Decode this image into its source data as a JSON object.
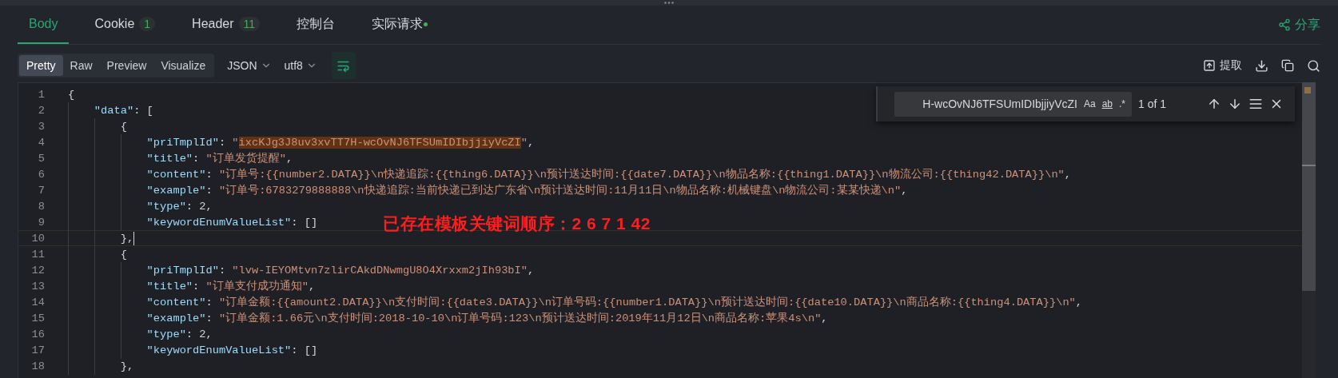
{
  "tabs": [
    {
      "label": "Body",
      "selected": true
    },
    {
      "label": "Cookie",
      "badge": "1",
      "selected": false
    },
    {
      "label": "Header",
      "badge": "11",
      "selected": false
    },
    {
      "label": "控制台",
      "selected": false
    },
    {
      "label": "实际请求",
      "dot": true,
      "selected": false
    }
  ],
  "share": {
    "label": "分享"
  },
  "view_modes": [
    {
      "label": "Pretty",
      "selected": true
    },
    {
      "label": "Raw",
      "selected": false
    },
    {
      "label": "Preview",
      "selected": false
    },
    {
      "label": "Visualize",
      "selected": false
    }
  ],
  "dropdowns": [
    {
      "value": "JSON"
    },
    {
      "value": "utf8"
    }
  ],
  "wrap": {
    "on": true
  },
  "extract": {
    "label": "提取"
  },
  "find": {
    "value": "H-wcOvNJ6TFSUmIDIbjjiyVcZI",
    "options": [
      {
        "label": "Aa"
      },
      {
        "label": "ab"
      },
      {
        "label": ".*"
      }
    ],
    "count": "1 of 1"
  },
  "annotation": "已存在模板关键词顺序：2 6 7 1 42",
  "lines": [
    {
      "number": "1",
      "current": false,
      "tokens": [
        {
          "kind": "punct",
          "text": "{"
        }
      ]
    },
    {
      "number": "2",
      "current": false,
      "tokens": [
        {
          "kind": "key",
          "text": "    \"data\""
        },
        {
          "kind": "punct",
          "text": ": ["
        }
      ]
    },
    {
      "number": "3",
      "current": false,
      "tokens": [
        {
          "kind": "punct",
          "text": "        {"
        }
      ]
    },
    {
      "number": "4",
      "current": false,
      "tokens": [
        {
          "kind": "key",
          "text": "            \"priTmplId\""
        },
        {
          "kind": "punct",
          "text": ": "
        },
        {
          "kind": "string",
          "text": "\""
        },
        {
          "kind": "match",
          "text": "ixcKJg3J8uv3xvTT7H-wcOvNJ6TFSUmIDIbjjiyVcZI"
        },
        {
          "kind": "string",
          "text": "\""
        },
        {
          "kind": "punct",
          "text": ","
        }
      ]
    },
    {
      "number": "5",
      "current": false,
      "tokens": [
        {
          "kind": "key",
          "text": "            \"title\""
        },
        {
          "kind": "punct",
          "text": ": "
        },
        {
          "kind": "string",
          "text": "\"订单发货提醒\""
        },
        {
          "kind": "punct",
          "text": ","
        }
      ]
    },
    {
      "number": "6",
      "current": false,
      "tokens": [
        {
          "kind": "key",
          "text": "            \"content\""
        },
        {
          "kind": "punct",
          "text": ": "
        },
        {
          "kind": "string",
          "text": "\"订单号:{{number2.DATA}}\\n快递追踪:{{thing6.DATA}}\\n预计送达时间:{{date7.DATA}}\\n物品名称:{{thing1.DATA}}\\n物流公司:{{thing42.DATA}}\\n\""
        },
        {
          "kind": "punct",
          "text": ","
        }
      ]
    },
    {
      "number": "7",
      "current": false,
      "tokens": [
        {
          "kind": "key",
          "text": "            \"example\""
        },
        {
          "kind": "punct",
          "text": ": "
        },
        {
          "kind": "string",
          "text": "\"订单号:6783279888888\\n快递追踪:当前快递已到达广东省\\n预计送达时间:11月11日\\n物品名称:机械键盘\\n物流公司:某某快递\\n\""
        },
        {
          "kind": "punct",
          "text": ","
        }
      ]
    },
    {
      "number": "8",
      "current": false,
      "tokens": [
        {
          "kind": "key",
          "text": "            \"type\""
        },
        {
          "kind": "punct",
          "text": ": "
        },
        {
          "kind": "number",
          "text": "2"
        },
        {
          "kind": "punct",
          "text": ","
        }
      ]
    },
    {
      "number": "9",
      "current": false,
      "tokens": [
        {
          "kind": "key",
          "text": "            \"keywordEnumValueList\""
        },
        {
          "kind": "punct",
          "text": ": []"
        }
      ]
    },
    {
      "number": "10",
      "current": true,
      "tokens": [
        {
          "kind": "punct",
          "text": "        },"
        }
      ]
    },
    {
      "number": "11",
      "current": false,
      "tokens": [
        {
          "kind": "punct",
          "text": "        {"
        }
      ]
    },
    {
      "number": "12",
      "current": false,
      "tokens": [
        {
          "kind": "key",
          "text": "            \"priTmplId\""
        },
        {
          "kind": "punct",
          "text": ": "
        },
        {
          "kind": "string",
          "text": "\"lvw-IEYOMtvn7zlirCAkdDNwmgU8O4Xrxxm2jIh93bI\""
        },
        {
          "kind": "punct",
          "text": ","
        }
      ]
    },
    {
      "number": "13",
      "current": false,
      "tokens": [
        {
          "kind": "key",
          "text": "            \"title\""
        },
        {
          "kind": "punct",
          "text": ": "
        },
        {
          "kind": "string",
          "text": "\"订单支付成功通知\""
        },
        {
          "kind": "punct",
          "text": ","
        }
      ]
    },
    {
      "number": "14",
      "current": false,
      "tokens": [
        {
          "kind": "key",
          "text": "            \"content\""
        },
        {
          "kind": "punct",
          "text": ": "
        },
        {
          "kind": "string",
          "text": "\"订单金额:{{amount2.DATA}}\\n支付时间:{{date3.DATA}}\\n订单号码:{{number1.DATA}}\\n预计送达时间:{{date10.DATA}}\\n商品名称:{{thing4.DATA}}\\n\""
        },
        {
          "kind": "punct",
          "text": ","
        }
      ]
    },
    {
      "number": "15",
      "current": false,
      "tokens": [
        {
          "kind": "key",
          "text": "            \"example\""
        },
        {
          "kind": "punct",
          "text": ": "
        },
        {
          "kind": "string",
          "text": "\"订单金额:1.66元\\n支付时间:2018-10-10\\n订单号码:123\\n预计送达时间:2019年11月12日\\n商品名称:苹果4s\\n\""
        },
        {
          "kind": "punct",
          "text": ","
        }
      ]
    },
    {
      "number": "16",
      "current": false,
      "tokens": [
        {
          "kind": "key",
          "text": "            \"type\""
        },
        {
          "kind": "punct",
          "text": ": "
        },
        {
          "kind": "number",
          "text": "2"
        },
        {
          "kind": "punct",
          "text": ","
        }
      ]
    },
    {
      "number": "17",
      "current": false,
      "tokens": [
        {
          "kind": "key",
          "text": "            \"keywordEnumValueList\""
        },
        {
          "kind": "punct",
          "text": ": []"
        }
      ]
    },
    {
      "number": "18",
      "current": false,
      "tokens": [
        {
          "kind": "punct",
          "text": "        },"
        }
      ]
    }
  ]
}
